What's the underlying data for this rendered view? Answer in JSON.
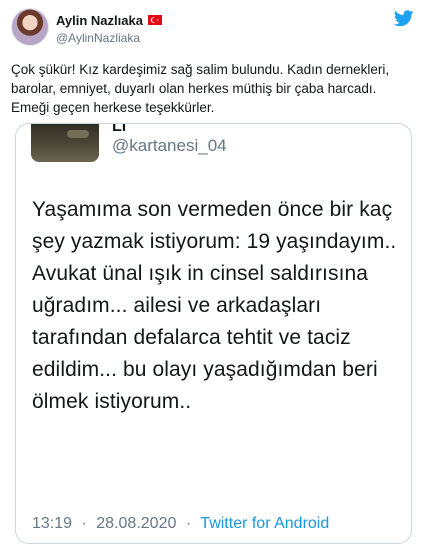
{
  "author": {
    "display_name": "Aylin Nazlıaka",
    "handle": "@AylinNazliaka"
  },
  "tweet_text": "Çok şükür! Kız kardeşimiz sağ salim bulundu. Kadın dernekleri, barolar, emniyet, duyarlı olan herkes müthiş bir çaba harcadı. Emeği geçen herkese teşekkürler.",
  "quoted": {
    "name_fragment": "Li",
    "handle": "@kartanesi_04",
    "text": "Yaşamıma son vermeden önce bir kaç şey yazmak istiyorum: 19 yaşındayım.. Avukat ünal ışık in cinsel saldırısına uğradım... ailesi ve arkadaşları tarafından defalarca tehtit ve taciz edildim... bu olayı yaşadığımdan beri ölmek istiyorum..",
    "time": "13:19",
    "separator": "·",
    "date": "28.08.2020",
    "source_separator": "·",
    "source": "Twitter for Android"
  },
  "icons": {
    "flag": "turkey-flag-icon",
    "logo": "twitter-bird-icon"
  },
  "colors": {
    "twitter_blue": "#1da1f2",
    "link_blue": "#1b95e0",
    "secondary_text": "#657786",
    "border": "#ccd6dd"
  }
}
